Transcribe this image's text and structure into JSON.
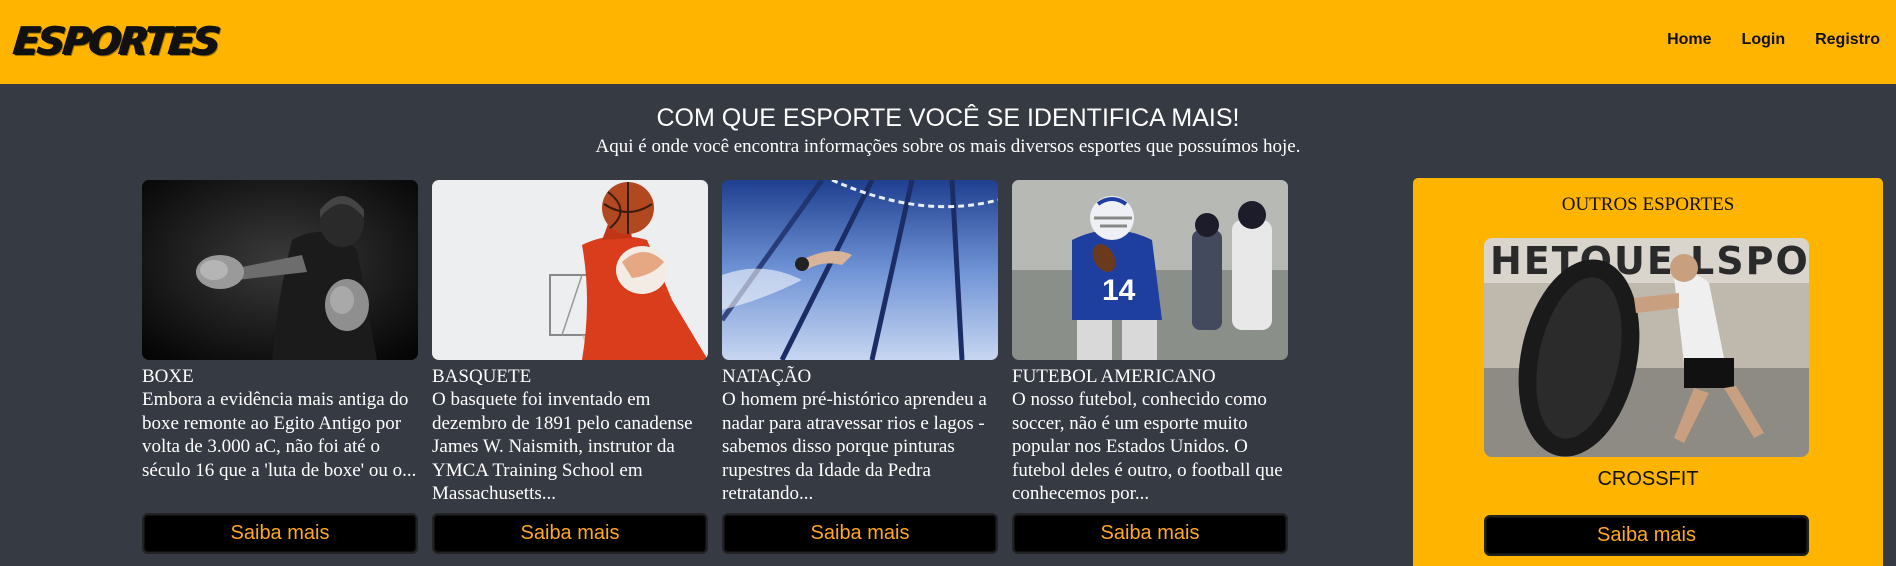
{
  "navbar": {
    "logo_text": "ESPORTES",
    "links": [
      {
        "label": "Home"
      },
      {
        "label": "Login"
      },
      {
        "label": "Registro"
      }
    ]
  },
  "hero": {
    "title": "COM QUE ESPORTE VOCÊ SE IDENTIFICA MAIS!",
    "subtitle": "Aqui é onde você encontra informações sobre os mais diversos esportes que possuímos hoje."
  },
  "cards": [
    {
      "title": "BOXE",
      "description": "Embora a evidência mais antiga do boxe remonte ao Egito Antigo por volta de 3.000 aC, não foi até o século 16 que a 'luta de boxe' ou o...",
      "button_label": "Saiba mais",
      "image": "boxer-photo"
    },
    {
      "title": "BASQUETE",
      "description": "O basquete foi inventado em dezembro de 1891 pelo canadense James W. Naismith, instrutor da YMCA Training School em Massachusetts...",
      "button_label": "Saiba mais",
      "image": "basketball-photo"
    },
    {
      "title": "NATAÇÃO",
      "description": "O homem pré-histórico aprendeu a nadar para atravessar rios e lagos - sabemos disso porque pinturas rupestres da Idade da Pedra retratando...",
      "button_label": "Saiba mais",
      "image": "swimming-photo"
    },
    {
      "title": "FUTEBOL AMERICANO",
      "description": "O nosso futebol, conhecido como soccer, não é um esporte muito popular nos Estados Unidos. O futebol deles é outro, o football que conhecemos por...",
      "button_label": "Saiba mais",
      "image": "football-photo"
    }
  ],
  "sidebar": {
    "title": "OUTROS ESPORTES",
    "sport_label": "CROSSFIT",
    "button_label": "Saiba mais",
    "image": "crossfit-photo"
  },
  "colors": {
    "accent": "#ffb400",
    "background": "#363a42",
    "button_text": "#ffa726",
    "button_bg": "#000000"
  }
}
